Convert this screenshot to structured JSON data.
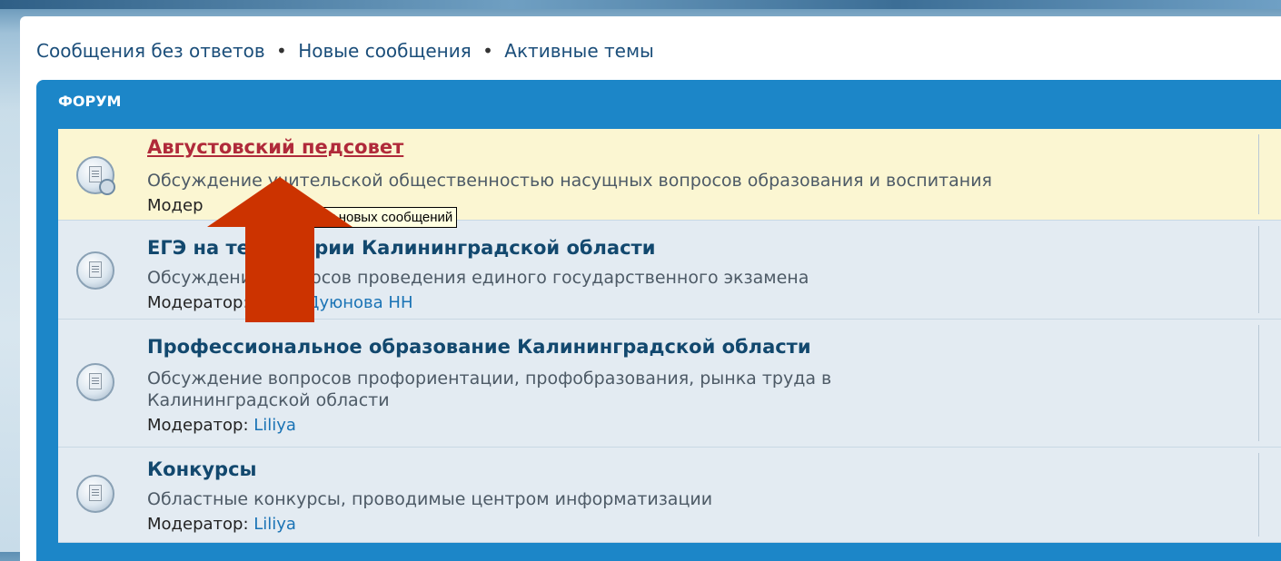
{
  "nav": {
    "unanswered": "Сообщения без ответов",
    "sep1": "•",
    "new": "Новые сообщения",
    "sep2": "•",
    "active": "Активные темы"
  },
  "forum_header": "ФОРУМ",
  "forums": [
    {
      "title": "Августовский педсовет",
      "description": "Обсуждение учительской общественностью насущных вопросов образования и воспитания",
      "moderator_label": "Модер"
    },
    {
      "title": "ЕГЭ на территории Калининградской области",
      "description": "Обсуждение вопросов проведения единого государственного экзамена",
      "moderator_label": "Модератор:",
      "moderators": "Liliya, Дуюнова НН"
    },
    {
      "title": "Профессиональное образование Калининградской области",
      "description_line1": "Обсуждение вопросов профориентации, профобразования, рынка труда в",
      "description_line2": "Калининградской области",
      "moderator_label": "Модератор:",
      "moderators": "Liliya"
    },
    {
      "title": "Конкурсы",
      "description": "Областные конкурсы, проводимые центром информатизации",
      "moderator_label": "Модератор:",
      "moderators": "Liliya"
    }
  ],
  "tooltip": "Нет новых сообщений",
  "colors": {
    "header_blue": "#1c86c8",
    "highlight_row": "#fbf6d2",
    "row_bg": "#e3ebf2",
    "arrow": "#cc3300"
  }
}
